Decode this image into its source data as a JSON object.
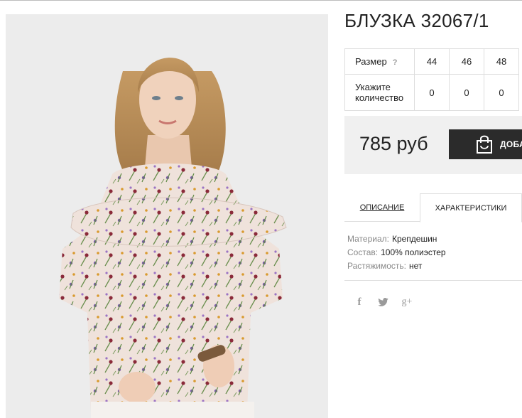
{
  "product": {
    "title": "БЛУЗКА 32067/1",
    "image_alt": "product-photo"
  },
  "size_table": {
    "size_label": "Размер",
    "help_glyph": "?",
    "sizes": [
      "44",
      "46",
      "48"
    ],
    "qty_label_line1": "Укажите",
    "qty_label_line2": "количество",
    "quantities": [
      "0",
      "0",
      "0"
    ]
  },
  "purchase": {
    "price": "785 руб",
    "add_button_label": "ДОБА",
    "add_button_icon": "shopping-bag-icon"
  },
  "tabs": {
    "description": "ОПИСАНИЕ",
    "characteristics": "ХАРАКТЕРИСТИКИ",
    "active": "characteristics"
  },
  "specs": [
    {
      "key": "Материал:",
      "value": "Крепдешин"
    },
    {
      "key": "Состав:",
      "value": "100% полиэстер"
    },
    {
      "key": "Растяжимость:",
      "value": "нет"
    }
  ],
  "social": {
    "facebook": "f",
    "twitter_icon": "twitter-icon",
    "googleplus": "g+"
  },
  "colors": {
    "button_bg": "#2b2b2b",
    "price_box_bg": "#f0f0f0",
    "border": "#dedede"
  }
}
